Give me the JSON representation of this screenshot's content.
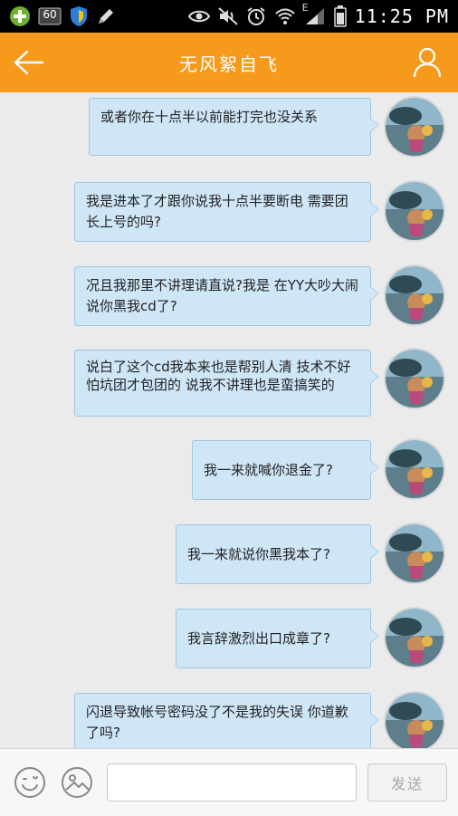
{
  "status_bar": {
    "time": "11:25 PM",
    "network_label": "E",
    "notification_badge": "60"
  },
  "header": {
    "title": "无风絮自飞"
  },
  "messages": [
    {
      "text": "或者你在十点半以前能打完也没关系"
    },
    {
      "text": "我是进本了才跟你说我十点半要断电 需要团长上号的吗?"
    },
    {
      "text": "况且我那里不讲理请直说?我是 在YY大吵大闹说你黑我cd了?"
    },
    {
      "text": "说白了这个cd我本来也是帮别人清 技术不好怕坑团才包团的 说我不讲理也是蛮搞笑的"
    },
    {
      "text": "我一来就喊你退金了?"
    },
    {
      "text": "我一来就说你黑我本了?"
    },
    {
      "text": "我言辞激烈出口成章了?"
    },
    {
      "text": "闪退导致帐号密码没了不是我的失误 你道歉了吗?"
    }
  ],
  "input_bar": {
    "placeholder": "",
    "send_label": "发送"
  },
  "colors": {
    "header": "#f59a1b",
    "bubble": "#cfe6f7",
    "bubble_border": "#9ec6e2",
    "background": "#ebebeb"
  }
}
